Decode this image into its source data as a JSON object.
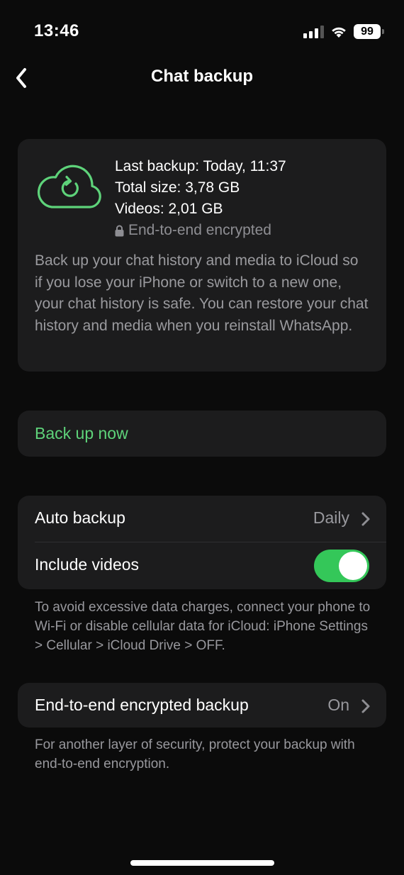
{
  "status_bar": {
    "time": "13:46",
    "battery_level": "99",
    "signal_bars_active": 3,
    "signal_bars_total": 4,
    "icons": [
      "cellular-signal-icon",
      "wifi-icon",
      "battery-icon"
    ]
  },
  "nav": {
    "back_icon": "chevron-left-icon",
    "title": "Chat backup"
  },
  "backup_info": {
    "icon": "cloud-sync-icon",
    "last_backup": "Last backup: Today, 11:37",
    "total_size": "Total size: 3,78 GB",
    "videos": "Videos: 2,01 GB",
    "encryption_icon": "lock-icon",
    "encryption": "End-to-end encrypted",
    "description": "Back up your chat history and media to iCloud so if you lose your iPhone or switch to a new one, your chat history is safe. You can restore your chat history and media when you reinstall WhatsApp."
  },
  "backup_now": {
    "label": "Back up now"
  },
  "settings": {
    "auto_backup": {
      "label": "Auto backup",
      "value": "Daily"
    },
    "include_videos": {
      "label": "Include videos",
      "enabled": true
    },
    "footnote": "To avoid excessive data charges, connect your phone to Wi-Fi or disable cellular data for iCloud: iPhone Settings > Cellular > iCloud Drive > OFF."
  },
  "e2e_backup": {
    "label": "End-to-end encrypted backup",
    "value": "On",
    "footnote": "For another layer of security, protect your backup with end-to-end encryption."
  },
  "colors": {
    "accent_green": "#5ed37a",
    "toggle_on": "#34c759",
    "card_bg": "#1c1c1d",
    "background": "#0b0b0b",
    "secondary_text": "#98989d"
  }
}
